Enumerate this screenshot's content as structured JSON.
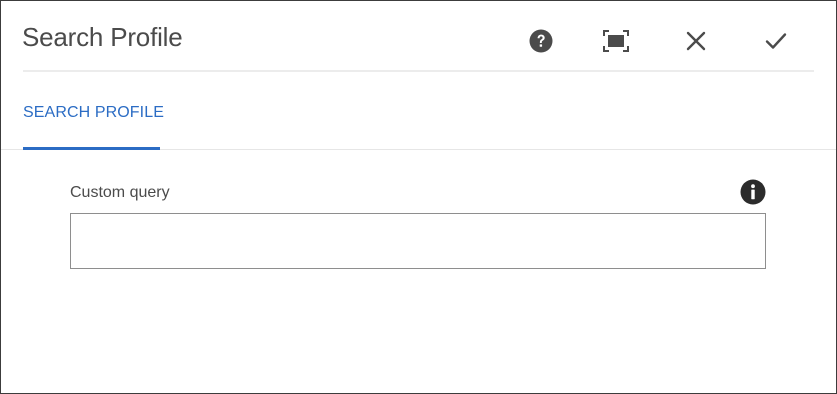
{
  "dialog": {
    "title": "Search Profile"
  },
  "header": {
    "actions": [
      {
        "name": "help",
        "icon": "help-circle-icon"
      },
      {
        "name": "fullscreen",
        "icon": "fullscreen-icon"
      },
      {
        "name": "close",
        "icon": "close-icon"
      },
      {
        "name": "done",
        "icon": "checkmark-icon"
      }
    ]
  },
  "tabs": [
    {
      "label": "SEARCH PROFILE",
      "selected": true
    }
  ],
  "form": {
    "custom_query": {
      "label": "Custom query",
      "value": "",
      "placeholder": "",
      "info_icon": "info-circle-icon"
    }
  },
  "colors": {
    "accent": "#2b6cc4",
    "text": "#4b4b4b",
    "icon": "#4b4b4b",
    "border": "#8e8e8e"
  }
}
